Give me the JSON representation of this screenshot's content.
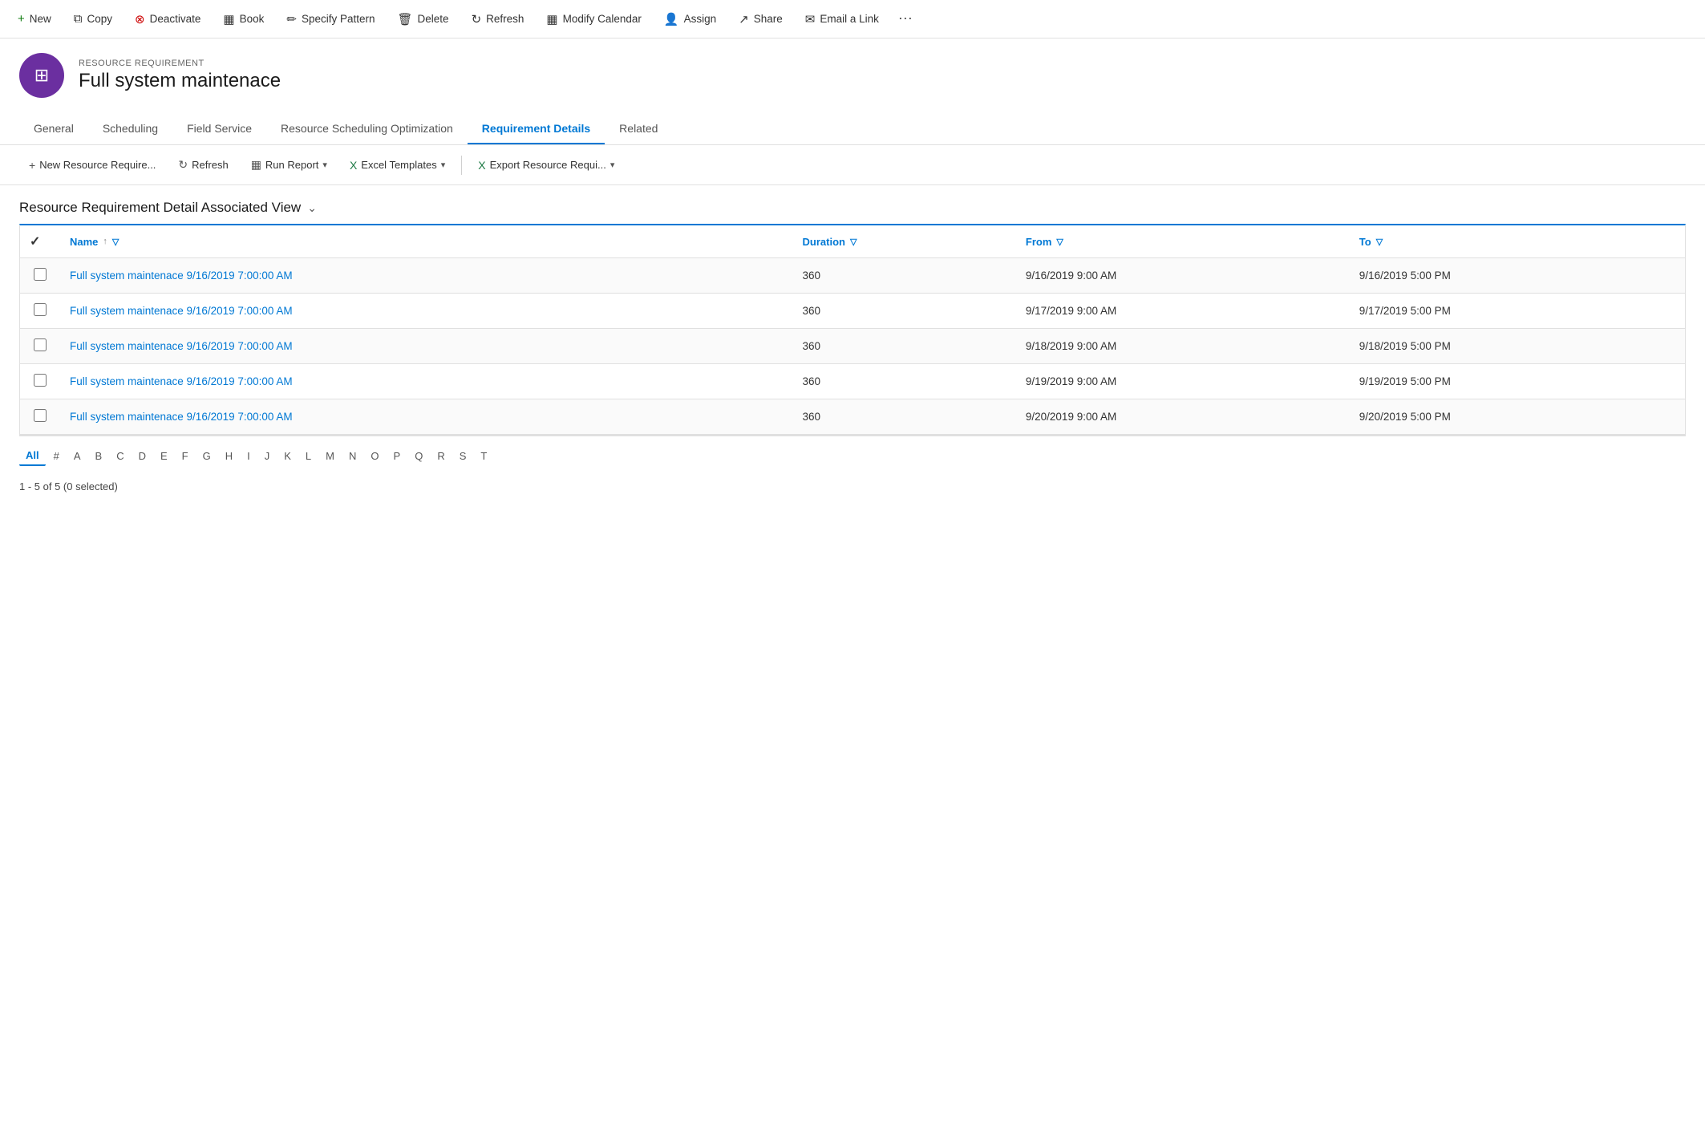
{
  "toolbar": {
    "buttons": [
      {
        "id": "new",
        "label": "New",
        "icon": "+"
      },
      {
        "id": "copy",
        "label": "Copy",
        "icon": "⧉"
      },
      {
        "id": "deactivate",
        "label": "Deactivate",
        "icon": "⊗"
      },
      {
        "id": "book",
        "label": "Book",
        "icon": "📅"
      },
      {
        "id": "specify-pattern",
        "label": "Specify Pattern",
        "icon": "✏"
      },
      {
        "id": "delete",
        "label": "Delete",
        "icon": "🗑"
      },
      {
        "id": "refresh",
        "label": "Refresh",
        "icon": "↻"
      },
      {
        "id": "modify-calendar",
        "label": "Modify Calendar",
        "icon": "📅"
      },
      {
        "id": "assign",
        "label": "Assign",
        "icon": "👤"
      },
      {
        "id": "share",
        "label": "Share",
        "icon": "↗"
      },
      {
        "id": "email-a-link",
        "label": "Email a Link",
        "icon": "✉"
      }
    ]
  },
  "record": {
    "type": "RESOURCE REQUIREMENT",
    "title": "Full system maintenace",
    "icon": "⊞"
  },
  "tabs": [
    {
      "id": "general",
      "label": "General",
      "active": false
    },
    {
      "id": "scheduling",
      "label": "Scheduling",
      "active": false
    },
    {
      "id": "field-service",
      "label": "Field Service",
      "active": false
    },
    {
      "id": "resource-scheduling-optimization",
      "label": "Resource Scheduling Optimization",
      "active": false
    },
    {
      "id": "requirement-details",
      "label": "Requirement Details",
      "active": true
    },
    {
      "id": "related",
      "label": "Related",
      "active": false
    }
  ],
  "subToolbar": {
    "buttons": [
      {
        "id": "new-resource-require",
        "label": "New Resource Require...",
        "icon": "+",
        "dropdown": false
      },
      {
        "id": "refresh-sub",
        "label": "Refresh",
        "icon": "↻",
        "dropdown": false
      },
      {
        "id": "run-report",
        "label": "Run Report",
        "icon": "📊",
        "dropdown": true
      },
      {
        "id": "excel-templates",
        "label": "Excel Templates",
        "icon": "📗",
        "dropdown": true
      },
      {
        "id": "export-resource-requi",
        "label": "Export Resource Requi...",
        "icon": "📗",
        "dropdown": true
      }
    ]
  },
  "viewTitle": "Resource Requirement Detail Associated View",
  "table": {
    "columns": [
      {
        "id": "name",
        "label": "Name",
        "sortable": true,
        "filterable": true
      },
      {
        "id": "duration",
        "label": "Duration",
        "sortable": false,
        "filterable": true
      },
      {
        "id": "from",
        "label": "From",
        "sortable": false,
        "filterable": true
      },
      {
        "id": "to",
        "label": "To",
        "sortable": false,
        "filterable": true
      }
    ],
    "rows": [
      {
        "name": "Full system maintenace 9/16/2019 7:00:00 AM",
        "duration": "360",
        "from": "9/16/2019 9:00 AM",
        "to": "9/16/2019 5:00 PM"
      },
      {
        "name": "Full system maintenace 9/16/2019 7:00:00 AM",
        "duration": "360",
        "from": "9/17/2019 9:00 AM",
        "to": "9/17/2019 5:00 PM"
      },
      {
        "name": "Full system maintenace 9/16/2019 7:00:00 AM",
        "duration": "360",
        "from": "9/18/2019 9:00 AM",
        "to": "9/18/2019 5:00 PM"
      },
      {
        "name": "Full system maintenace 9/16/2019 7:00:00 AM",
        "duration": "360",
        "from": "9/19/2019 9:00 AM",
        "to": "9/19/2019 5:00 PM"
      },
      {
        "name": "Full system maintenace 9/16/2019 7:00:00 AM",
        "duration": "360",
        "from": "9/20/2019 9:00 AM",
        "to": "9/20/2019 5:00 PM"
      }
    ]
  },
  "alphaNav": [
    "All",
    "#",
    "A",
    "B",
    "C",
    "D",
    "E",
    "F",
    "G",
    "H",
    "I",
    "J",
    "K",
    "L",
    "M",
    "N",
    "O",
    "P",
    "Q",
    "R",
    "S",
    "T"
  ],
  "statusBar": "1 - 5 of 5 (0 selected)"
}
